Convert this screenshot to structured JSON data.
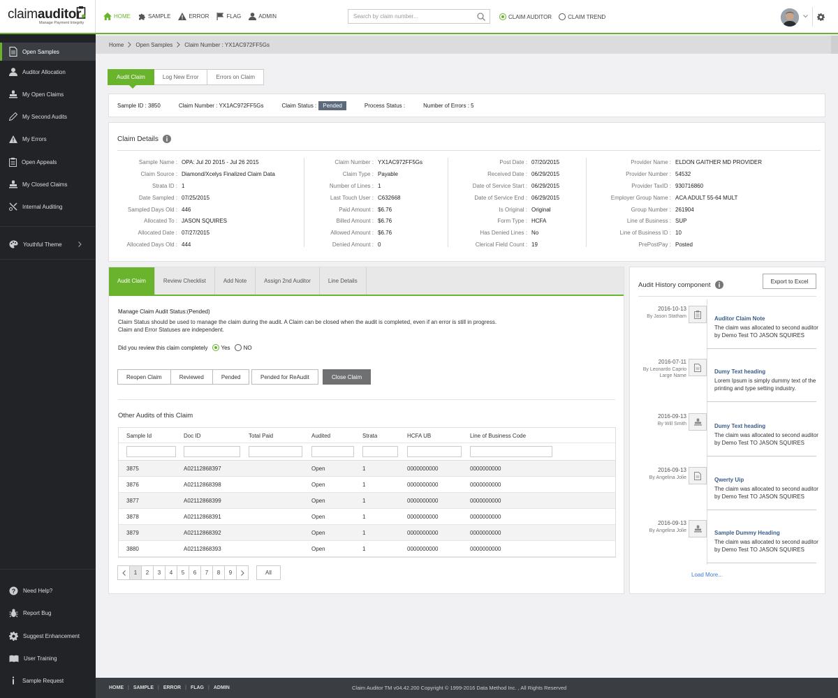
{
  "brand": {
    "name_light": "claim",
    "name_bold": "auditor",
    "tagline": "Manage Payment Integrity"
  },
  "topnav": [
    {
      "label": "HOME",
      "icon": "home-icon"
    },
    {
      "label": "SAMPLE",
      "icon": "puzzle-icon"
    },
    {
      "label": "ERROR",
      "icon": "warning-icon"
    },
    {
      "label": "FLAG",
      "icon": "flag-icon"
    },
    {
      "label": "ADMIN",
      "icon": "user-icon"
    }
  ],
  "search": {
    "placeholder": "Search by claim number..."
  },
  "mode_toggle": [
    {
      "label": "CLAIM AUDITOR",
      "selected": true
    },
    {
      "label": "CLAIM TREND",
      "selected": false
    }
  ],
  "sidebar": {
    "items": [
      {
        "label": "Open Samples"
      },
      {
        "label": "Auditor Allocation"
      },
      {
        "label": "My Open Claims"
      },
      {
        "label": "My Second Audits"
      },
      {
        "label": "My Errors"
      },
      {
        "label": "Open Appeals"
      },
      {
        "label": "My Closed Claims"
      },
      {
        "label": "Internal Auditing"
      },
      {
        "label": "Youthful Theme"
      }
    ],
    "bottom": [
      {
        "label": "Need Help?"
      },
      {
        "label": "Report Bug"
      },
      {
        "label": "Suggest Enhancement"
      },
      {
        "label": "User Training"
      },
      {
        "label": "Sample Request"
      }
    ]
  },
  "breadcrumb": [
    "Home",
    "Open Samples",
    "Claim Number : YX1AC972FF5Gs"
  ],
  "claim_tabs": [
    "Audit Claim",
    "Log New Error",
    "Errors on Claim"
  ],
  "status": {
    "sample_id": "Sample ID : 3850",
    "claim_number": "Claim Number : YX1AC972FF5Gs",
    "claim_status_label": "Claim Status :",
    "claim_status_value": "Pended",
    "process_status": "Process Status :",
    "errors": "Number of Errors : 5"
  },
  "details": {
    "title": "Claim Details",
    "col1": [
      {
        "label": "Sample Name :",
        "value": "OPA: Jul 20 2015 - Jul 26 2015"
      },
      {
        "label": "Claim Source :",
        "value": "Diamond/Xcelys Finalized Claim Data"
      },
      {
        "label": "Strata ID :",
        "value": "1"
      },
      {
        "label": "Date Sampled :",
        "value": "07/25/2015"
      },
      {
        "label": "Sampled Days Old :",
        "value": "446"
      },
      {
        "label": "Allocated To :",
        "value": "JASON SQUIRES"
      },
      {
        "label": "Allocated Date :",
        "value": "07/27/2015"
      },
      {
        "label": "Allocated Days Old :",
        "value": "444"
      }
    ],
    "col2": [
      {
        "label": "Claim Number :",
        "value": "YX1AC972FF5Gs"
      },
      {
        "label": "Claim Type :",
        "value": "Payable"
      },
      {
        "label": "Number of Lines :",
        "value": "1"
      },
      {
        "label": "Last Touch User :",
        "value": "C632668"
      },
      {
        "label": "Paid Amount :",
        "value": "$6.76"
      },
      {
        "label": "Billed Amount :",
        "value": "$6.76"
      },
      {
        "label": "Allowed Amount :",
        "value": "$6.76"
      },
      {
        "label": "Denied Amount :",
        "value": "0"
      }
    ],
    "col3": [
      {
        "label": "Post Date :",
        "value": "07/20/2015"
      },
      {
        "label": "Received Date :",
        "value": "06/29/2015"
      },
      {
        "label": "Date of Service Start :",
        "value": "06/29/2015"
      },
      {
        "label": "Date of Service End :",
        "value": "06/29/2015"
      },
      {
        "label": "Is Original :",
        "value": "Original"
      },
      {
        "label": "Form Type :",
        "value": "HCFA"
      },
      {
        "label": "Has Denied Lines :",
        "value": "No"
      },
      {
        "label": "Clerical Field Count :",
        "value": "19"
      }
    ],
    "col4": [
      {
        "label": "Provider Name :",
        "value": "ELDON GAITHER MD PROVIDER"
      },
      {
        "label": "Provider Number :",
        "value": "54532"
      },
      {
        "label": "Provider TaxID :",
        "value": "930716860"
      },
      {
        "label": "Employer Group Name :",
        "value": "ACA ADULT 55-64 MULT"
      },
      {
        "label": "Group Number :",
        "value": "261904"
      },
      {
        "label": "Line of Business :",
        "value": "SUP"
      },
      {
        "label": "Line of Business ID :",
        "value": "10"
      },
      {
        "label": "PrePostPay :",
        "value": "Posted"
      }
    ]
  },
  "audit_tabs": [
    "Audit Claim",
    "Review Checklist",
    "Add Note",
    "Assign 2nd Auditor",
    "Line Details"
  ],
  "manage": {
    "title": "Manage Claim Audit Status:(Pended)",
    "desc1": "Claim Status should be used to manage the claim during the audit. A Claim can be closed when the audit is completed, even if an error is still in progress.",
    "desc2": "Claim and Error Statuses are independent.",
    "question": "Did you review this claim completely",
    "yes": "Yes",
    "no": "NO",
    "buttons": [
      "Reopen Claim",
      "Reviewed",
      "Pended"
    ],
    "reaudit": "Pended for ReAudit",
    "close": "Close Claim"
  },
  "other_audits": {
    "title": "Other Audits of this Claim",
    "columns": [
      "Sample Id",
      "Doc ID",
      "Total Paid",
      "Audited",
      "Strata",
      "HCFA UB",
      "Line of Business Code"
    ],
    "rows": [
      [
        "3875",
        "A02112868397",
        "",
        "Open",
        "1",
        "0000000000",
        "0000000000"
      ],
      [
        "3876",
        "A02112868398",
        "",
        "Open",
        "1",
        "0000000000",
        "0000000000"
      ],
      [
        "3877",
        "A02112868399",
        "",
        "Open",
        "1",
        "0000000000",
        "0000000000"
      ],
      [
        "3878",
        "A02112868391",
        "",
        "Open",
        "1",
        "0000000000",
        "0000000000"
      ],
      [
        "3879",
        "A02112868392",
        "",
        "Open",
        "1",
        "0000000000",
        "0000000000"
      ],
      [
        "3880",
        "A02112868393",
        "",
        "Open",
        "1",
        "0000000000",
        "0000000000"
      ]
    ],
    "pages": [
      "1",
      "2",
      "3",
      "4",
      "5",
      "6",
      "7",
      "8",
      "9"
    ],
    "all": "All"
  },
  "history": {
    "title": "Audit History component",
    "export": "Export to Excel",
    "entries": [
      {
        "date": "2016-10-13",
        "by": "By Jason Statham",
        "title": "Auditor Claim Note",
        "text": "The claim was allocated to second auditor by Demo Test TO JASON SQUIRES",
        "icon": "clipboard-icon"
      },
      {
        "date": "2016-07-11",
        "by": "By Leonardo Caprio Large Name",
        "title": "Dumy Text heading",
        "text": "Lorem Ipsum is simply dummy text of the printing and type setting industry.",
        "icon": "document-icon"
      },
      {
        "date": "2016-09-13",
        "by": "By Will Smith",
        "title": "Dumy Text heading",
        "text": "The claim was allocated to second auditor by Demo Test TO JASON SQUIRES",
        "icon": "stamp-icon"
      },
      {
        "date": "2016-09-13",
        "by": "By Angelina Jolie",
        "title": "Qwerty Uip",
        "text": "The claim was allocated to second auditor by Demo Test TO JASON SQUIRES",
        "icon": "document-icon"
      },
      {
        "date": "2016-09-13",
        "by": "By Angelina Jolie",
        "title": "Sample Dummy Heading",
        "text": "The claim was allocated to second auditor by Demo Test TO JASON SQUIRES",
        "icon": "stamp-icon"
      }
    ],
    "load_more": "Load More..."
  },
  "footer": {
    "links": [
      "HOME",
      "SAMPLE",
      "ERROR",
      "FLAG",
      "ADMIN"
    ],
    "copyright": "Claim Auditor TM v04.42.200 Copyright © 1999-2016 Data Method Inc. , All Rights Reserved"
  },
  "colors": {
    "accent": "#6ab42d",
    "sidebar": "#212326",
    "status_badge": "#5b6b7c",
    "link": "#3a5d8a"
  }
}
